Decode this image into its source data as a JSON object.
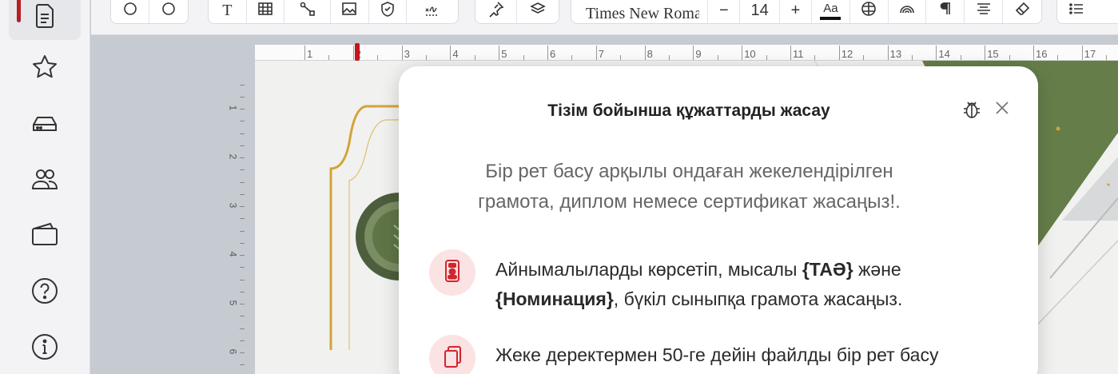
{
  "sidebar": {
    "items": [
      {
        "icon": "document-icon",
        "active": true
      },
      {
        "icon": "star-icon"
      },
      {
        "icon": "drive-icon"
      },
      {
        "icon": "users-icon"
      },
      {
        "icon": "wallet-icon"
      },
      {
        "icon": "help-icon"
      },
      {
        "icon": "info-icon"
      }
    ],
    "accent_color": "#b51e23"
  },
  "toolbar": {
    "font_name": "Times New Roman",
    "font_size": "14",
    "font_decrease": "−",
    "font_increase": "+",
    "text_tool": "T",
    "text_color_label": "Aa"
  },
  "ruler": {
    "h_numbers": [
      "1",
      "2",
      "3",
      "4",
      "5",
      "6",
      "7",
      "8",
      "9",
      "10",
      "11",
      "12",
      "13",
      "14",
      "15",
      "16",
      "17"
    ],
    "v_numbers": [
      "1",
      "2",
      "3",
      "4",
      "5",
      "6"
    ]
  },
  "modal": {
    "title": "Тізім бойынша құжаттарды жасау",
    "intro": "Бір рет басу арқылы ондаған жекелендірілген грамота, диплом немесе сертификат жасаңыз!.",
    "features": [
      {
        "icon": "variable-card-icon",
        "text_before": "Айнымалыларды көрсетіп, мысалы ",
        "var1": "{ТАӘ}",
        "text_middle": " және ",
        "var2": "{Номинация}",
        "text_after": ", бүкіл сыныпқа грамота жасаңыз."
      },
      {
        "icon": "multiple-files-icon",
        "text": "Жеке деректермен 50-ге дейін файлды бір рет басу"
      }
    ]
  }
}
